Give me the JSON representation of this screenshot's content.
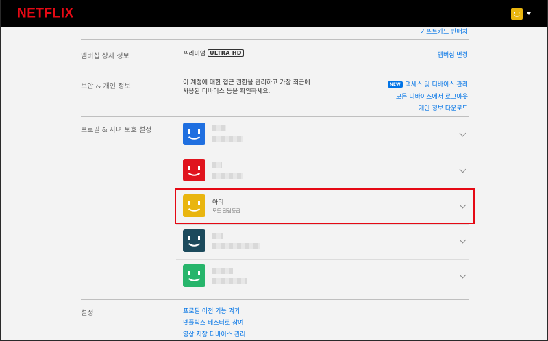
{
  "header": {
    "logo_text": "NETFLIX",
    "brand_color": "#e50914"
  },
  "top_links": {
    "gift_card_sales": "기프트카드 판매처"
  },
  "membership": {
    "label": "멤버십 상세 정보",
    "plan_name": "프리미엄",
    "plan_badge_a": "ULTRA",
    "plan_badge_b": "HD",
    "change_link": "멤버십 변경"
  },
  "security": {
    "label": "보안 & 개인 정보",
    "desc_line1": "이 계정에 대한 접근 권한을 관리하고 가장 최근에",
    "desc_line2": "사용된 디바이스 등을 확인하세요.",
    "new_badge": "NEW",
    "access_link": "액세스 및 디바이스 관리",
    "logout_link": "모든 디바이스에서 로그아웃",
    "download_link": "개인 정보 다운로드"
  },
  "profiles": {
    "label": "프로필 & 자녀 보호 설정",
    "items": [
      {
        "name": "",
        "subtitle": "",
        "color": "#1f6fe0",
        "selected": false
      },
      {
        "name": "",
        "subtitle": "",
        "color": "#e0141e",
        "selected": false
      },
      {
        "name": "아티",
        "subtitle": "모든 관람등급",
        "color": "#e9b50f",
        "selected": true
      },
      {
        "name": "",
        "subtitle": "",
        "color": "#1c4a5c",
        "selected": false
      },
      {
        "name": "",
        "subtitle": "",
        "color": "#27b56b",
        "selected": false
      }
    ]
  },
  "settings": {
    "label": "설정",
    "link1": "프로필 이전 기능 켜기",
    "link2": "넷플릭스 테스터로 참여",
    "link3": "영상 저장 디바이스 관리"
  },
  "icons": {
    "avatar": "smiley-avatar-icon",
    "expand": "chevron-down-icon",
    "nav_caret": "caret-down-icon"
  }
}
